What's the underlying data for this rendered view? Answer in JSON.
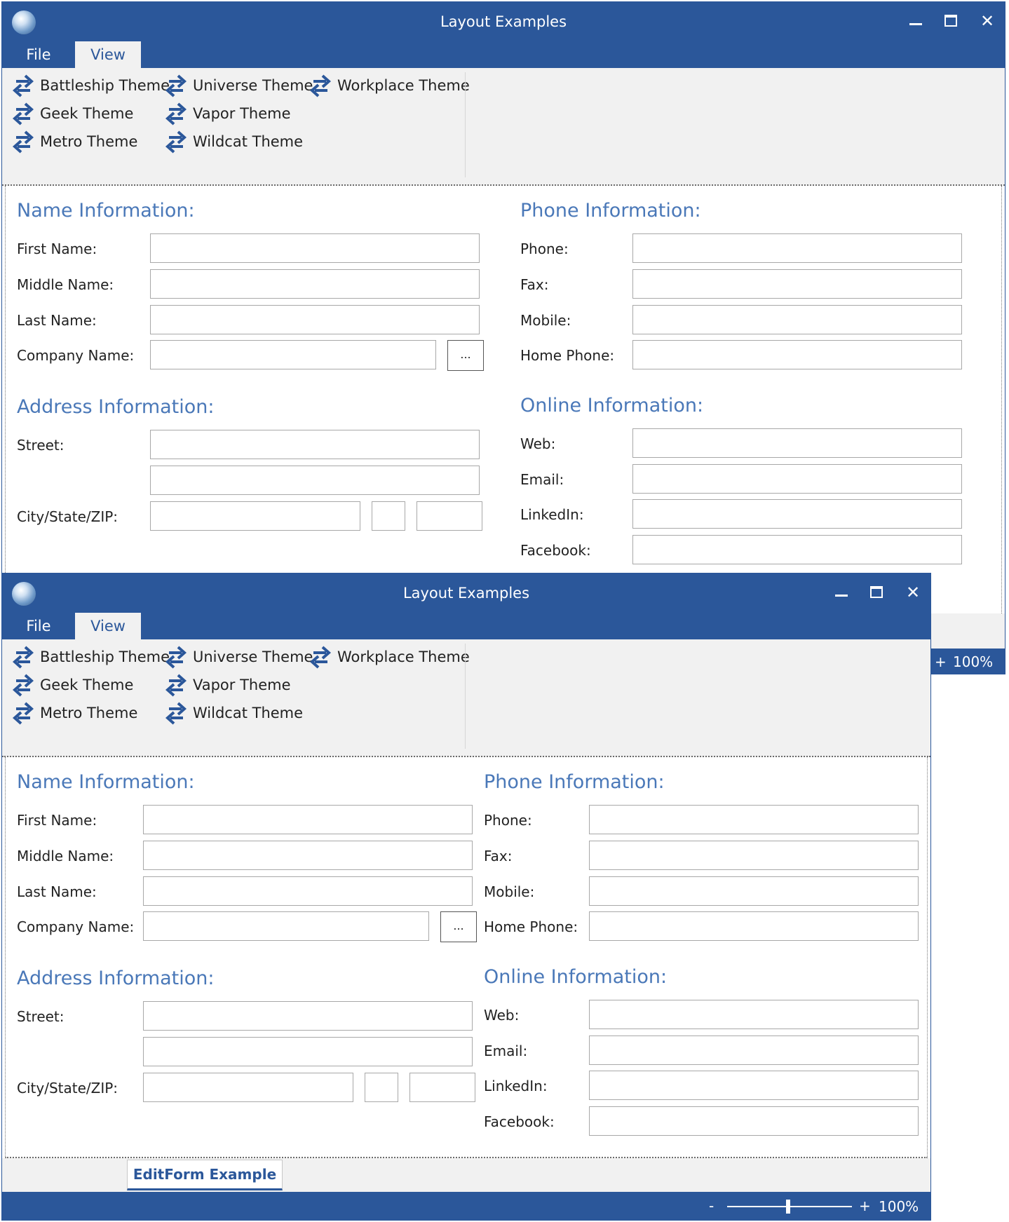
{
  "window": {
    "title": "Layout Examples",
    "minimize_glyph": "—",
    "close_glyph": "✕"
  },
  "menu": {
    "file": "File",
    "view": "View"
  },
  "themes": [
    "Battleship Theme",
    "Universe Theme",
    "Workplace Theme",
    "Geek Theme",
    "Vapor Theme",
    "Metro Theme",
    "Wildcat Theme"
  ],
  "sections": {
    "name": "Name Information:",
    "phone": "Phone Information:",
    "address": "Address Information:",
    "online": "Online Information:"
  },
  "labels": {
    "first_name": "First Name:",
    "middle_name": "Middle Name:",
    "last_name": "Last Name:",
    "company_name": "Company Name:",
    "street": "Street:",
    "city_state_zip": "City/State/ZIP:",
    "phone": "Phone:",
    "fax": "Fax:",
    "mobile": "Mobile:",
    "home_phone": "Home Phone:",
    "web": "Web:",
    "email": "Email:",
    "linkedin": "LinkedIn:",
    "facebook": "Facebook:"
  },
  "company_lookup_button": "...",
  "tabs": {
    "editform": "EditForm Example"
  },
  "status": {
    "zoom_minus": "-",
    "zoom_plus": "+",
    "zoom_value": "100%"
  },
  "colors": {
    "accent": "#2b579a",
    "section_heading": "#4a78b8",
    "ribbon": "#f1f1f1"
  },
  "icons": {
    "app": "globe-icon",
    "theme": "swap-arrows-icon"
  }
}
